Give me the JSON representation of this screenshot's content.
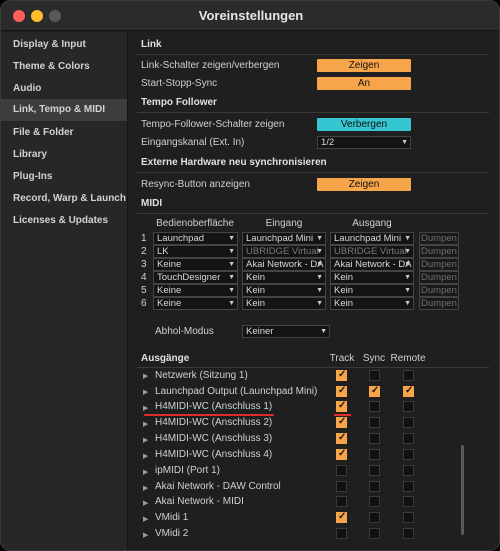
{
  "window": {
    "title": "Voreinstellungen"
  },
  "sidebar": {
    "items": [
      {
        "label": "Display & Input",
        "active": false
      },
      {
        "label": "Theme & Colors",
        "active": false
      },
      {
        "label": "Audio",
        "active": false
      },
      {
        "label": "Link, Tempo & MIDI",
        "active": true
      },
      {
        "label": "File & Folder",
        "active": false
      },
      {
        "label": "Library",
        "active": false
      },
      {
        "label": "Plug-Ins",
        "active": false
      },
      {
        "label": "Record, Warp & Launch",
        "active": false
      },
      {
        "label": "Licenses & Updates",
        "active": false
      }
    ]
  },
  "link": {
    "section": "Link",
    "show_toggle_label": "Link-Schalter zeigen/verbergen",
    "show_toggle_value": "Zeigen",
    "start_stop_label": "Start-Stopp-Sync",
    "start_stop_value": "An"
  },
  "tempo_follower": {
    "section": "Tempo Follower",
    "show_label": "Tempo-Follower-Schalter zeigen",
    "show_value": "Verbergen",
    "input_label": "Eingangskanal (Ext. In)",
    "input_value": "1/2"
  },
  "external": {
    "section": "Externe Hardware neu synchronisieren",
    "resync_label": "Resync-Button anzeigen",
    "resync_value": "Zeigen"
  },
  "midi": {
    "section": "MIDI",
    "col_surface": "Bedienoberfläche",
    "col_input": "Eingang",
    "col_output": "Ausgang",
    "dump_label": "Dumpen",
    "rows": [
      {
        "num": "1",
        "surface": "Launchpad",
        "input": "Launchpad Mini",
        "output": "Launchpad Mini",
        "input_dim": false,
        "output_dim": false
      },
      {
        "num": "2",
        "surface": "LK",
        "input": "UBRIDGE Virtual",
        "output": "UBRIDGE Virtual",
        "input_dim": true,
        "output_dim": true
      },
      {
        "num": "3",
        "surface": "Keine",
        "input": "Akai Network - DA",
        "output": "Akai Network - DA",
        "input_dim": false,
        "output_dim": false
      },
      {
        "num": "4",
        "surface": "TouchDesigner",
        "input": "Kein",
        "output": "Kein",
        "input_dim": false,
        "output_dim": false
      },
      {
        "num": "5",
        "surface": "Keine",
        "input": "Kein",
        "output": "Kein",
        "input_dim": false,
        "output_dim": false
      },
      {
        "num": "6",
        "surface": "Keine",
        "input": "Kein",
        "output": "Kein",
        "input_dim": false,
        "output_dim": false
      }
    ],
    "takeover_label": "Abhol-Modus",
    "takeover_value": "Keiner"
  },
  "outputs": {
    "header": "Ausgänge",
    "col_track": "Track",
    "col_sync": "Sync",
    "col_remote": "Remote",
    "ports": [
      {
        "name": "Netzwerk (Sitzung 1)",
        "track": true,
        "sync": false,
        "remote": false
      },
      {
        "name": "Launchpad Output (Launchpad Mini)",
        "track": true,
        "sync": true,
        "remote": true
      },
      {
        "name": "H4MIDI-WC (Anschluss 1)",
        "track": true,
        "sync": false,
        "remote": false
      },
      {
        "name": "H4MIDI-WC (Anschluss 2)",
        "track": true,
        "sync": false,
        "remote": false
      },
      {
        "name": "H4MIDI-WC (Anschluss 3)",
        "track": true,
        "sync": false,
        "remote": false
      },
      {
        "name": "H4MIDI-WC (Anschluss 4)",
        "track": true,
        "sync": false,
        "remote": false
      },
      {
        "name": "ipMIDI (Port 1)",
        "track": false,
        "sync": false,
        "remote": false
      },
      {
        "name": "Akai Network - DAW Control",
        "track": false,
        "sync": false,
        "remote": false
      },
      {
        "name": "Akai Network - MIDI",
        "track": false,
        "sync": false,
        "remote": false
      },
      {
        "name": "VMidi 1",
        "track": true,
        "sync": false,
        "remote": false
      },
      {
        "name": "VMidi 2",
        "track": false,
        "sync": false,
        "remote": false
      }
    ]
  },
  "colors": {
    "orange": "#f7a54a",
    "cyan": "#36c6d2",
    "annotation_red": "#e02b2b"
  }
}
